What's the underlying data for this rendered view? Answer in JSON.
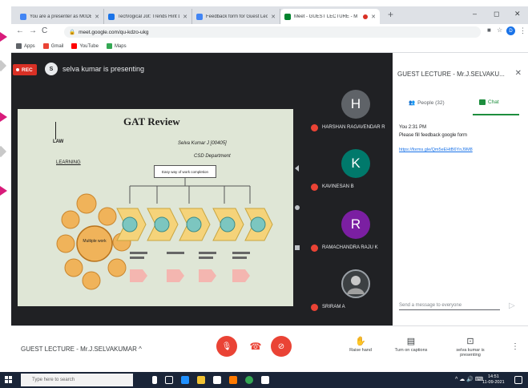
{
  "browser": {
    "tabs": [
      {
        "label": "You are a presenter as M0DE1E",
        "favicon_color": "#4285f4"
      },
      {
        "label": "Tech/ogical Jot: Trends Hint D",
        "favicon_color": "#1a73e8"
      },
      {
        "label": "Feedback form for Guest Lecture",
        "favicon_color": "#4285f4"
      },
      {
        "label": "Meet - GUEST LECTURE - M",
        "favicon_color": "#00832d",
        "active": true
      }
    ],
    "new_tab": "+",
    "minimize": "–",
    "maximize": "◻",
    "close": "✕",
    "url": "meet.google.com/qu-kdzo-ukg",
    "profile_initial": "D",
    "bookmarks": [
      {
        "label": "Apps",
        "color": "#5f6368"
      },
      {
        "label": "Gmail",
        "color": "#ea4335"
      },
      {
        "label": "YouTube",
        "color": "#ff0000"
      },
      {
        "label": "Maps",
        "color": "#34a853"
      }
    ]
  },
  "meet": {
    "rec_label": "REC",
    "presenter_text": "selva kumar is presenting",
    "presenter_initial": "S",
    "slide": {
      "title": "GAT Review",
      "presenter": "Selva Kumar J [00405]",
      "department": "CSD Department",
      "law": "LAW",
      "learning": "LEARNING",
      "center_label": "Multiple work",
      "easy_box": "Easy way of work completion"
    },
    "participants": [
      {
        "initial": "H",
        "name": "HARSHAN RAGAVENDAR R",
        "color": "#5f6368"
      },
      {
        "initial": "K",
        "name": "KAVINESAN B",
        "color": "#00796b"
      },
      {
        "initial": "R",
        "name": "RAMACHANDRA RAJU K",
        "color": "#7b1fa2"
      },
      {
        "initial": "",
        "name": "SRIRAM A",
        "color": "#3c4043"
      }
    ],
    "panel": {
      "title": "GUEST LECTURE - Mr.J.SELVAKU...",
      "close": "✕",
      "tab_people": "People (32)",
      "tab_chat": "Chat",
      "message_meta": "You  2:31 PM",
      "message_text": "Please fill feedback google form",
      "message_link": "https://forms.gle/Qm5eEHtB6YnJ9M8",
      "input_placeholder": "Send a message to everyone",
      "send": "▷"
    },
    "bottom": {
      "meeting_name": "GUEST LECTURE - Mr.J.SELVAKUMAR  ^",
      "raise_hand": "Raise hand",
      "captions": "Turn on captions",
      "presenting": "selva kumar is presenting",
      "more": "⋮"
    }
  },
  "taskbar": {
    "search_placeholder": "Type here to search",
    "time": "14:51",
    "date": "11-09-2021",
    "tray": "^ ☁ 🔊 ⌨"
  },
  "colors": {
    "meet_dark": "#202124",
    "hangup_red": "#ea4335",
    "chat_green": "#1e8e3e",
    "rail_pink": "#d81b7a"
  }
}
